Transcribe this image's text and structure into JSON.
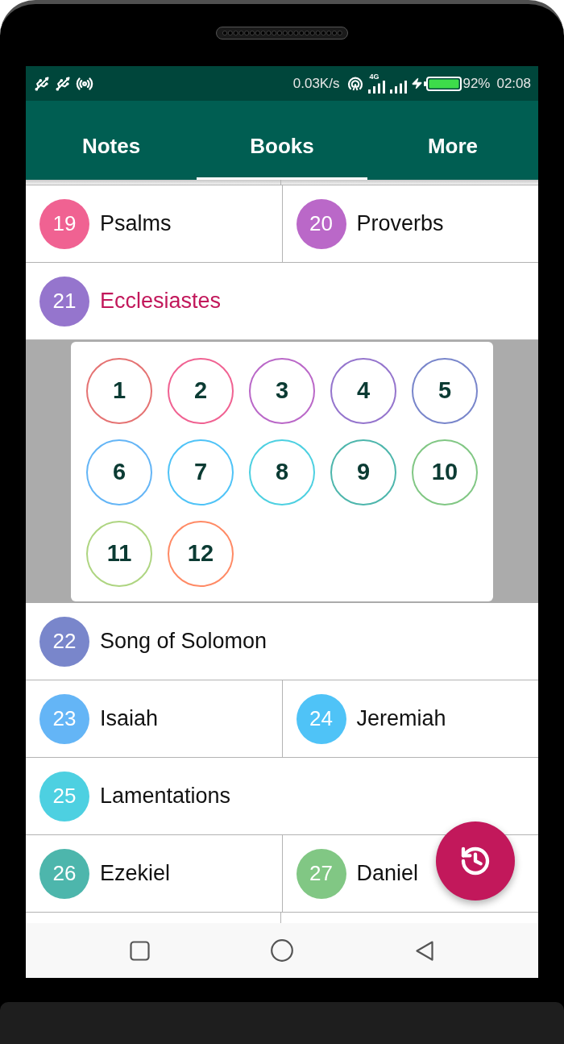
{
  "status_bar": {
    "speed": "0.03K/s",
    "network": "4G",
    "battery": "92%",
    "time": "02:08"
  },
  "tabs": [
    {
      "label": "Notes",
      "selected": false
    },
    {
      "label": "Books",
      "selected": true
    },
    {
      "label": "More",
      "selected": false
    }
  ],
  "rows": [
    {
      "kind": "books",
      "books": [
        {
          "number": "19",
          "name": "Psalms",
          "color": "#f06292",
          "selected": false
        },
        {
          "number": "20",
          "name": "Proverbs",
          "color": "#ba68c8",
          "selected": false
        }
      ]
    },
    {
      "kind": "books",
      "books": [
        {
          "number": "21",
          "name": "Ecclesiastes",
          "color": "#9575cd",
          "selected": true
        }
      ]
    },
    {
      "kind": "chapters",
      "chapters": [
        {
          "number": "1",
          "color": "#e57373"
        },
        {
          "number": "2",
          "color": "#f06292"
        },
        {
          "number": "3",
          "color": "#ba68c8"
        },
        {
          "number": "4",
          "color": "#9575cd"
        },
        {
          "number": "5",
          "color": "#7986cb"
        },
        {
          "number": "6",
          "color": "#64b5f6"
        },
        {
          "number": "7",
          "color": "#4fc3f7"
        },
        {
          "number": "8",
          "color": "#4dd0e1"
        },
        {
          "number": "9",
          "color": "#4db6ac"
        },
        {
          "number": "10",
          "color": "#81c784"
        },
        {
          "number": "11",
          "color": "#aed581"
        },
        {
          "number": "12",
          "color": "#ff8a65"
        }
      ]
    },
    {
      "kind": "books",
      "books": [
        {
          "number": "22",
          "name": "Song of Solomon",
          "color": "#7986cb",
          "selected": false
        }
      ]
    },
    {
      "kind": "books",
      "books": [
        {
          "number": "23",
          "name": "Isaiah",
          "color": "#64b5f6",
          "selected": false
        },
        {
          "number": "24",
          "name": "Jeremiah",
          "color": "#4fc3f7",
          "selected": false
        }
      ]
    },
    {
      "kind": "books",
      "books": [
        {
          "number": "25",
          "name": "Lamentations",
          "color": "#4dd0e1",
          "selected": false
        }
      ]
    },
    {
      "kind": "books",
      "books": [
        {
          "number": "26",
          "name": "Ezekiel",
          "color": "#4db6ac",
          "selected": false
        },
        {
          "number": "27",
          "name": "Daniel",
          "color": "#81c784",
          "selected": false
        }
      ]
    }
  ]
}
